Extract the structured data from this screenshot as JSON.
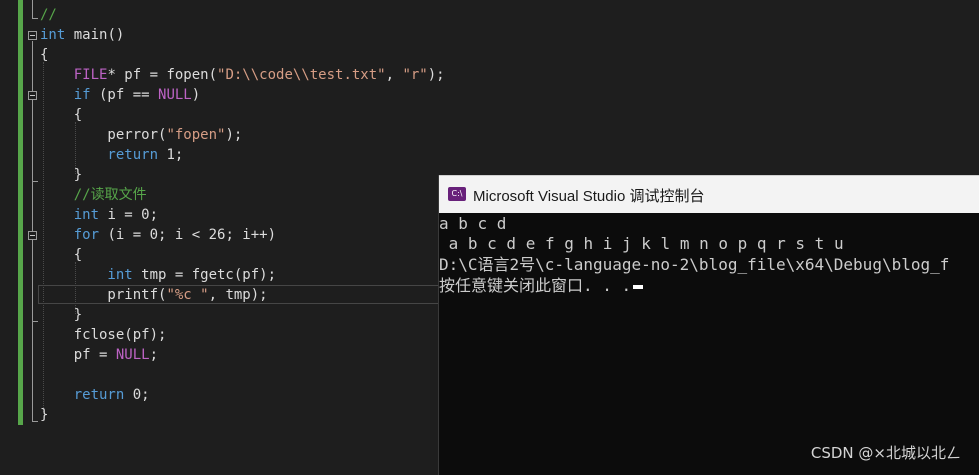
{
  "editor": {
    "lines": [
      {
        "parts": [
          {
            "c": "cmt",
            "t": "//"
          }
        ]
      },
      {
        "parts": [
          {
            "c": "kw",
            "t": "int"
          },
          {
            "c": "txt",
            "t": " main()"
          }
        ]
      },
      {
        "parts": [
          {
            "c": "txt",
            "t": "{"
          }
        ]
      },
      {
        "parts": [
          {
            "c": "mac",
            "t": "    FILE"
          },
          {
            "c": "txt",
            "t": "* pf = fopen("
          },
          {
            "c": "str",
            "t": "\"D:\\\\code\\\\test.txt\""
          },
          {
            "c": "txt",
            "t": ", "
          },
          {
            "c": "str",
            "t": "\"r\""
          },
          {
            "c": "txt",
            "t": ");"
          }
        ]
      },
      {
        "parts": [
          {
            "c": "kw",
            "t": "    if"
          },
          {
            "c": "txt",
            "t": " (pf == "
          },
          {
            "c": "mac",
            "t": "NULL"
          },
          {
            "c": "txt",
            "t": ")"
          }
        ]
      },
      {
        "parts": [
          {
            "c": "txt",
            "t": "    {"
          }
        ]
      },
      {
        "parts": [
          {
            "c": "txt",
            "t": "        perror("
          },
          {
            "c": "str",
            "t": "\"fopen\""
          },
          {
            "c": "txt",
            "t": ");"
          }
        ]
      },
      {
        "parts": [
          {
            "c": "kw",
            "t": "        return"
          },
          {
            "c": "txt",
            "t": " 1;"
          }
        ]
      },
      {
        "parts": [
          {
            "c": "txt",
            "t": "    }"
          }
        ]
      },
      {
        "parts": [
          {
            "c": "cmt",
            "t": "    //读取文件"
          }
        ]
      },
      {
        "parts": [
          {
            "c": "kw",
            "t": "    int"
          },
          {
            "c": "txt",
            "t": " i = 0;"
          }
        ]
      },
      {
        "parts": [
          {
            "c": "kw",
            "t": "    for"
          },
          {
            "c": "txt",
            "t": " (i = 0; i < 26; i++)"
          }
        ]
      },
      {
        "parts": [
          {
            "c": "txt",
            "t": "    {"
          }
        ]
      },
      {
        "parts": [
          {
            "c": "kw",
            "t": "        int"
          },
          {
            "c": "txt",
            "t": " tmp = fgetc(pf);"
          }
        ]
      },
      {
        "parts": [
          {
            "c": "txt",
            "t": "        printf("
          },
          {
            "c": "str",
            "t": "\"%c \""
          },
          {
            "c": "txt",
            "t": ", tmp);"
          }
        ]
      },
      {
        "parts": [
          {
            "c": "txt",
            "t": "    }"
          }
        ]
      },
      {
        "parts": [
          {
            "c": "txt",
            "t": "    fclose(pf);"
          }
        ]
      },
      {
        "parts": [
          {
            "c": "txt",
            "t": "    pf = "
          },
          {
            "c": "mac",
            "t": "NULL"
          },
          {
            "c": "txt",
            "t": ";"
          }
        ]
      },
      {
        "parts": []
      },
      {
        "parts": [
          {
            "c": "kw",
            "t": "    return"
          },
          {
            "c": "txt",
            "t": " 0;"
          }
        ]
      },
      {
        "parts": [
          {
            "c": "txt",
            "t": "}"
          }
        ]
      }
    ]
  },
  "console": {
    "title": "Microsoft Visual Studio 调试控制台",
    "icon_label": "C:\\",
    "lines": [
      "a b c d",
      " a b c d e f g h i j k l m n o p q r s t u",
      "D:\\C语言2号\\c-language-no-2\\blog_file\\x64\\Debug\\blog_f",
      "按任意键关闭此窗口. . ."
    ]
  },
  "watermark": "CSDN @⨯北城以北ㄥ"
}
